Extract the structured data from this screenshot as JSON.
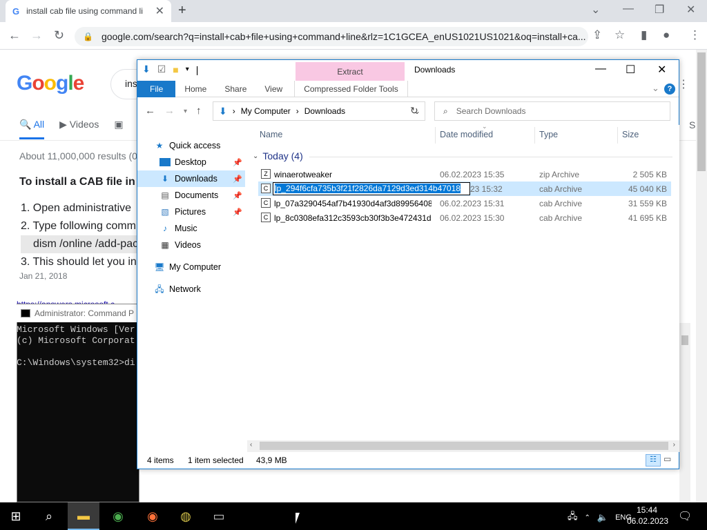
{
  "browser": {
    "tab_title": "install cab file using command li",
    "tab_close": "✕",
    "new_tab": "+",
    "url": "google.com/search?q=install+cab+file+using+command+line&rlz=1C1GCEA_enUS1021US1021&oq=install+ca..."
  },
  "google": {
    "logo": "Google",
    "search_value": "ins",
    "tabs": [
      "All",
      "Videos"
    ],
    "right_tab": "S",
    "about": "About 11,000,000 results (0",
    "snippet_heading": "To install a CAB file in",
    "snippet_items": [
      "1. Open administrative",
      "2. Type following comm",
      "dism /online /add-pac",
      "3. This should let you in"
    ],
    "date": "Jan 21, 2018",
    "link_partial": "https://answers.microsoft.c..."
  },
  "cmd": {
    "title": "Administrator: Command P",
    "lines": "Microsoft Windows [Ver\n(c) Microsoft Corporat\n\nC:\\Windows\\system32>di"
  },
  "explorer": {
    "title": "Downloads",
    "context_tab": "Extract",
    "ribbon_tabs": [
      "File",
      "Home",
      "Share",
      "View",
      "Compressed Folder Tools"
    ],
    "help": "?",
    "address": [
      "My Computer",
      "Downloads"
    ],
    "search_placeholder": "Search Downloads",
    "nav": {
      "quick_access": "Quick access",
      "desktop": "Desktop",
      "downloads": "Downloads",
      "documents": "Documents",
      "pictures": "Pictures",
      "music": "Music",
      "videos": "Videos",
      "my_computer": "My Computer",
      "network": "Network"
    },
    "columns": [
      "Name",
      "Date modified",
      "Type",
      "Size"
    ],
    "group_label": "Today (4)",
    "files": [
      {
        "name": "winaerotweaker",
        "date": "06.02.2023 15:35",
        "type": "zip Archive",
        "size": "2 505 KB"
      },
      {
        "name": "lp_294f6cfa735b3f21f2826da7129d3ed314b47018",
        "date": "06.02.2023 15:32",
        "date_visible": "23 15:32",
        "type": "cab Archive",
        "size": "45 040 KB"
      },
      {
        "name": "lp_07a3290454af7b41930d4af3d89956408...",
        "date": "06.02.2023 15:31",
        "type": "cab Archive",
        "size": "31 559 KB"
      },
      {
        "name": "lp_8c0308efa312c3593cb30f3b3e472431d...",
        "date": "06.02.2023 15:30",
        "type": "cab Archive",
        "size": "41 695 KB"
      }
    ],
    "status": {
      "items": "4 items",
      "selected": "1 item selected",
      "size": "43,9 MB"
    }
  },
  "taskbar": {
    "language": "ENG",
    "time": "15:44",
    "date": "06.02.2023"
  },
  "colors": {
    "accent": "#1979ca",
    "context_tab": "#f9c8e3",
    "selection": "#cce8ff"
  }
}
